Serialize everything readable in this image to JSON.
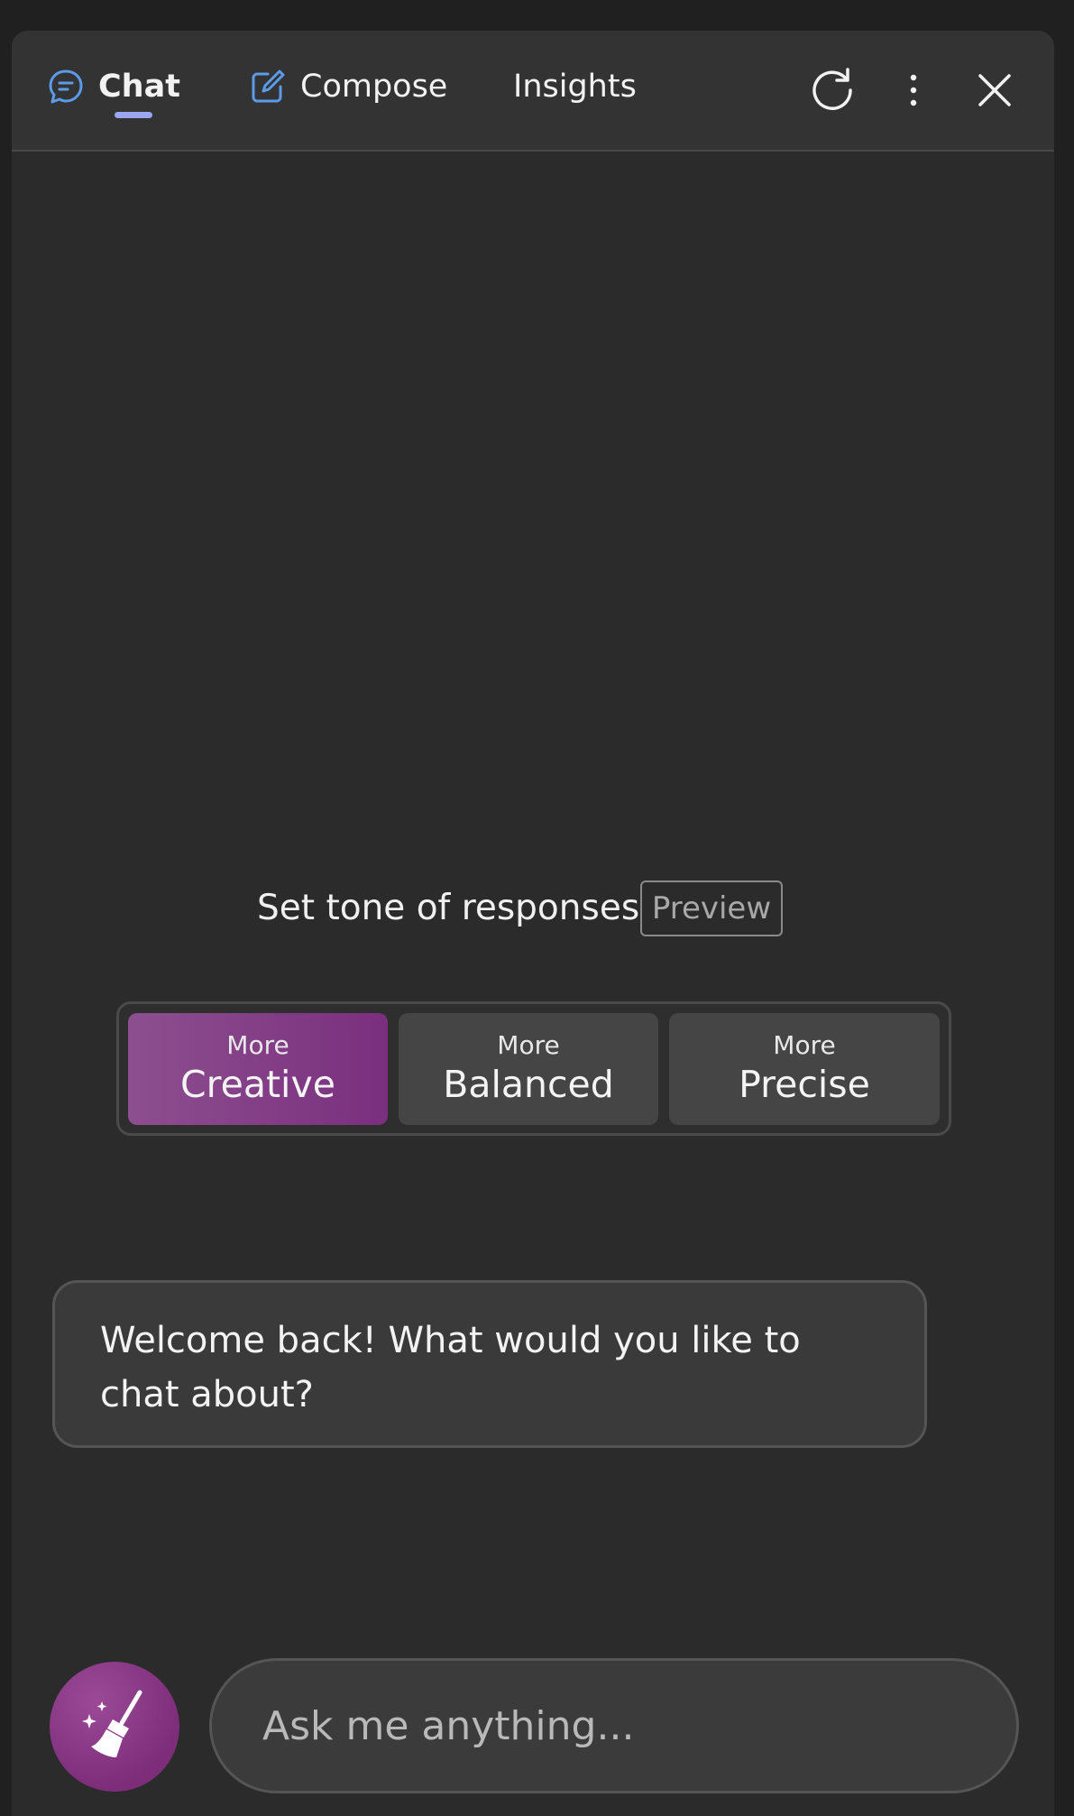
{
  "header": {
    "tabs": [
      {
        "label": "Chat",
        "active": true,
        "icon": "chat-bubble-icon"
      },
      {
        "label": "Compose",
        "active": false,
        "icon": "compose-icon"
      },
      {
        "label": "Insights",
        "active": false
      }
    ],
    "actions": [
      "refresh-icon",
      "more-options-icon",
      "close-icon"
    ]
  },
  "tone": {
    "label": "Set tone of responses",
    "badge": "Preview",
    "options": [
      {
        "small": "More",
        "big": "Creative",
        "selected": true
      },
      {
        "small": "More",
        "big": "Balanced",
        "selected": false
      },
      {
        "small": "More",
        "big": "Precise",
        "selected": false
      }
    ]
  },
  "conversation": {
    "welcome": "Welcome back! What would you like to chat about?"
  },
  "composer": {
    "placeholder": "Ask me anything...",
    "new_topic_icon": "broom-sparkle-icon"
  },
  "colors": {
    "accent_tab": "#9aa6f2",
    "icon_blue": "#5b9be8",
    "creative_gradient_start": "#8d4f8f",
    "creative_gradient_end": "#7a2f7e"
  }
}
